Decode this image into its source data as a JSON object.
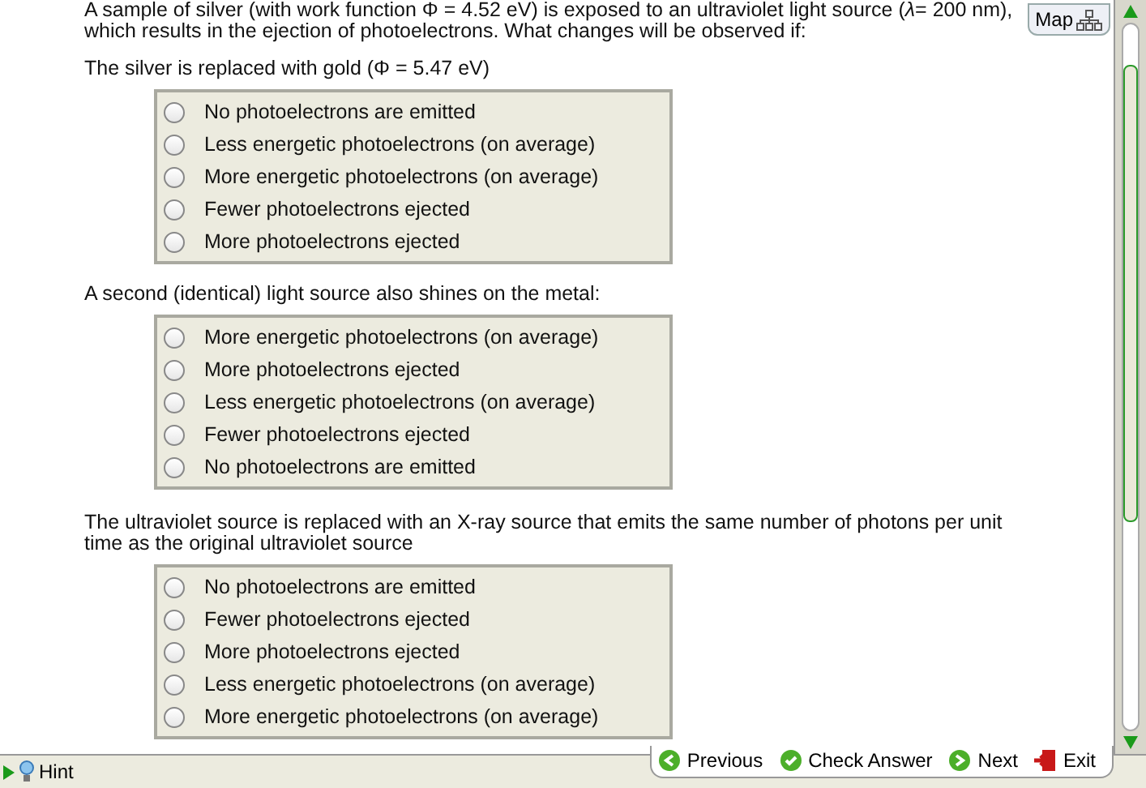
{
  "question": {
    "intro": "A sample of silver (with work function Φ = 4.52 eV) is exposed to an ultraviolet light source (*λ*= 200 nm), which results in the ejection of photoelectrons. What changes will be observed if:"
  },
  "map_button": {
    "label": "Map"
  },
  "parts": [
    {
      "prompt": "The silver is replaced with gold (Φ = 5.47 eV)",
      "options": [
        {
          "label": "No photoelectrons are emitted",
          "selected": false
        },
        {
          "label": "Less energetic photoelectrons (on average)",
          "selected": false
        },
        {
          "label": "More energetic photoelectrons (on average)",
          "selected": false
        },
        {
          "label": "Fewer photoelectrons ejected",
          "selected": false
        },
        {
          "label": "More photoelectrons ejected",
          "selected": false
        }
      ]
    },
    {
      "prompt": "A second (identical) light source also shines on the metal:",
      "options": [
        {
          "label": "More energetic photoelectrons (on average)",
          "selected": false
        },
        {
          "label": "More photoelectrons ejected",
          "selected": false
        },
        {
          "label": "Less energetic photoelectrons (on average)",
          "selected": false
        },
        {
          "label": "Fewer photoelectrons ejected",
          "selected": false
        },
        {
          "label": "No photoelectrons are emitted",
          "selected": false
        }
      ]
    },
    {
      "prompt": "The ultraviolet source is replaced with an X-ray source that emits the same number of photons per unit time as the original ultraviolet source",
      "options": [
        {
          "label": "No photoelectrons are emitted",
          "selected": false
        },
        {
          "label": "Fewer photoelectrons ejected",
          "selected": false
        },
        {
          "label": "More photoelectrons ejected",
          "selected": false
        },
        {
          "label": "Less energetic photoelectrons (on average)",
          "selected": false
        },
        {
          "label": "More energetic photoelectrons (on average)",
          "selected": false
        }
      ]
    }
  ],
  "nav": [
    {
      "kind": "previous",
      "label": "Previous"
    },
    {
      "kind": "check",
      "label": "Check Answer"
    },
    {
      "kind": "next",
      "label": "Next"
    },
    {
      "kind": "exit",
      "label": "Exit"
    }
  ],
  "hint": {
    "label": "Hint"
  }
}
